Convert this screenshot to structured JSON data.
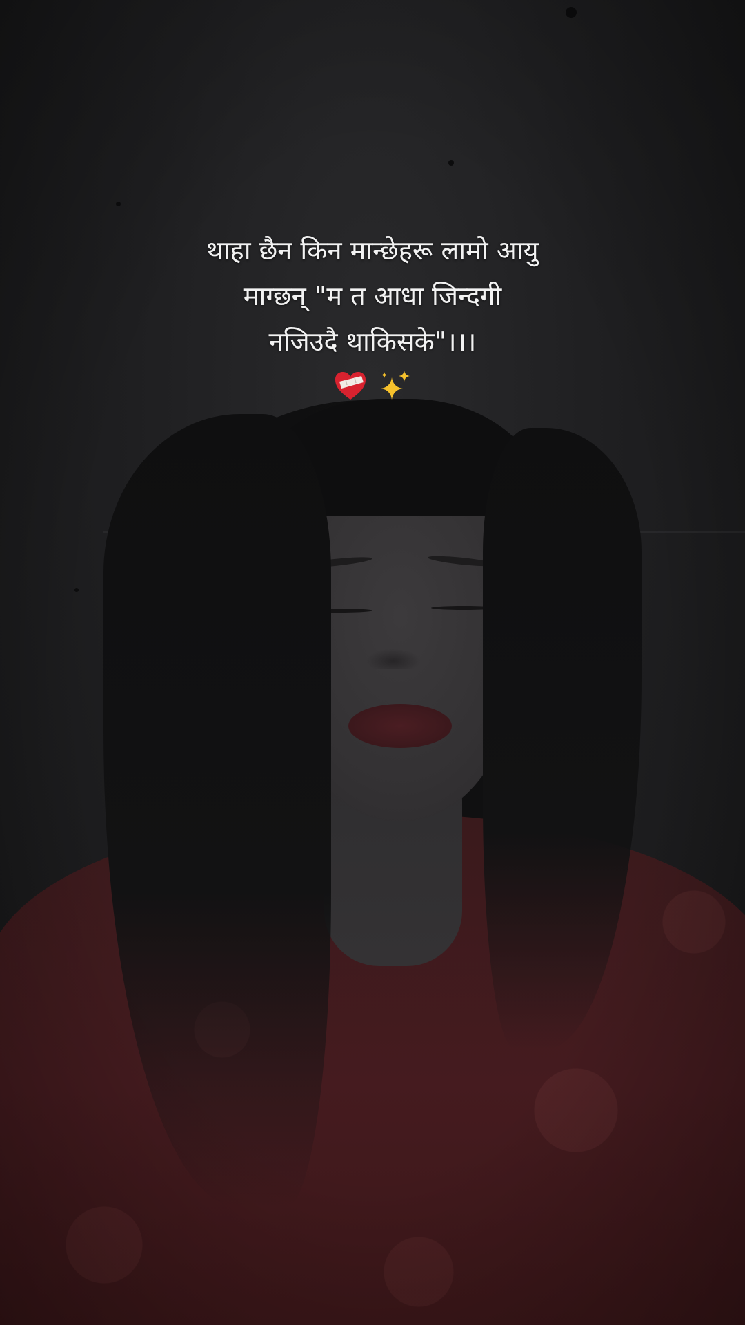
{
  "caption": {
    "lines": [
      "थाहा छैन किन मान्छेहरू लामो आयु",
      "माग्छन् \"म त आधा जिन्दगी",
      "नजिउदै थाकिसके\"।।।"
    ],
    "emojis": [
      "mending-heart-icon",
      "sparkles-icon"
    ]
  },
  "colors": {
    "background": "#1e1e20",
    "text": "#f2f2f2",
    "blouse": "#451b1f"
  }
}
